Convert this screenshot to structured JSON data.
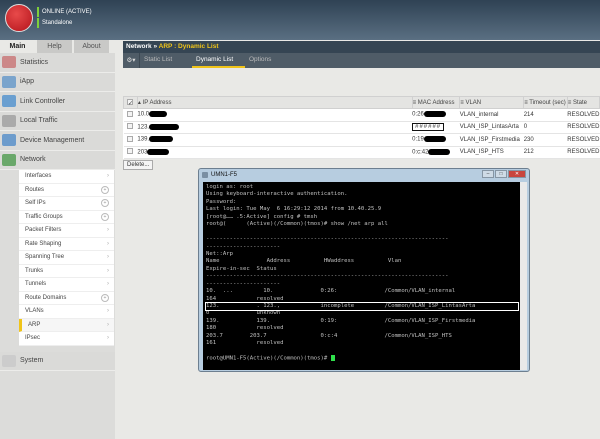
{
  "header": {
    "logo": "f5",
    "status": "ONLINE (ACTIVE)",
    "mode": "Standalone"
  },
  "main_tabs": [
    "Main",
    "Help",
    "About"
  ],
  "sidebar": {
    "sections": [
      "Statistics",
      "iApp",
      "Link Controller",
      "Local Traffic",
      "Device Management",
      "Network"
    ],
    "network_items": [
      {
        "label": "Interfaces",
        "type": "chevron"
      },
      {
        "label": "Routes",
        "type": "plus"
      },
      {
        "label": "Self IPs",
        "type": "plus"
      },
      {
        "label": "Traffic Groups",
        "type": "plus"
      },
      {
        "label": "Packet Filters",
        "type": "chevron"
      },
      {
        "label": "Rate Shaping",
        "type": "chevron"
      },
      {
        "label": "Spanning Tree",
        "type": "chevron"
      },
      {
        "label": "Trunks",
        "type": "chevron"
      },
      {
        "label": "Tunnels",
        "type": "chevron"
      },
      {
        "label": "Route Domains",
        "type": "plus"
      },
      {
        "label": "VLANs",
        "type": "chevron"
      },
      {
        "label": "ARP",
        "type": "chevron",
        "active": true
      },
      {
        "label": "IPsec",
        "type": "chevron"
      }
    ],
    "system": "System"
  },
  "breadcrumb": {
    "root": "Network",
    "sep": "»",
    "current": "ARP : Dynamic List"
  },
  "content_tabs": [
    "Static List",
    "Dynamic List",
    "Options"
  ],
  "table": {
    "headers": [
      "IP Address",
      "MAC Address",
      "VLAN",
      "Timeout (sec)",
      "State"
    ],
    "rows": [
      {
        "ip": "10.0",
        "mac": "0:26",
        "vlan": "VLAN_internal",
        "timeout": "214",
        "state": "RESOLVED"
      },
      {
        "ip": "123.",
        "mac": "######",
        "vlan": "VLAN_ISP_LintasArta",
        "timeout": "0",
        "state": "RESOLVED"
      },
      {
        "ip": "139.",
        "mac": "0:19",
        "vlan": "VLAN_ISP_Firstmedia",
        "timeout": "230",
        "state": "RESOLVED"
      },
      {
        "ip": "203",
        "mac": "0:c:42",
        "vlan": "VLAN_ISP_HTS",
        "timeout": "212",
        "state": "RESOLVED"
      }
    ],
    "delete": "Delete..."
  },
  "terminal": {
    "title": "UMN1-F5",
    "lines": [
      "login as: root",
      "Using keyboard-interactive authentication.",
      "Password:",
      "Last login: Tue May  6 16:29:12 2014 from 10.40.25.9",
      "[root@…… .5:Active] config # tmsh",
      "root@(      (Active)(/Common)(tmos)# show /net arp all",
      "",
      "------------------------------------------------------------------------",
      "----------------------",
      "Net::Arp",
      "Name              Address          HWaddress          Vlan",
      "Expire-in-sec  Status",
      "------------------------------------------------------------------------",
      "----------------------",
      "10.  ...         10.              0:26:              /Common/VLAN_internal",
      "164            resolved",
      "123.           . 123.,            incomplete         /Common/VLAN_ISP_LintasArta",
      "0              unknown",
      "139.           139.               0:19:              /Common/VLAN_ISP_Firstmedia",
      "180            resolved",
      "203.7        203.7                0:c:4              /Common/VLAN_ISP_HTS",
      "161            resolved",
      ""
    ],
    "prompt": "root@UMN1-F5(Active)(/Common)(tmos)# "
  }
}
